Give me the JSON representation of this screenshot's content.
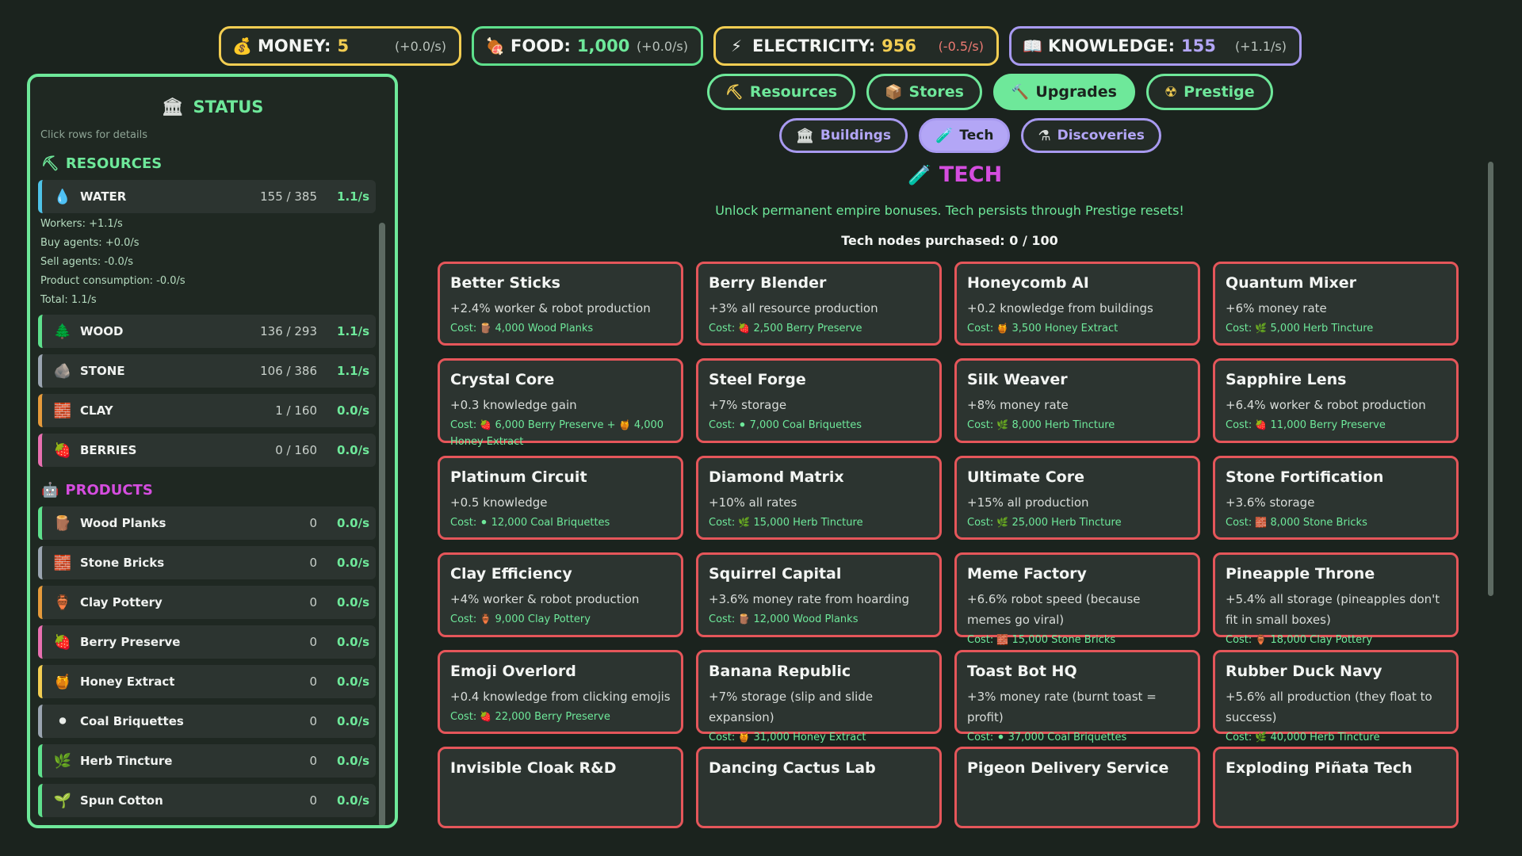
{
  "topbar": [
    {
      "id": "money",
      "icon": "💰",
      "icon_name": "money-bag-icon",
      "label": "MONEY:",
      "value": "5",
      "rate": "(+0.0/s)"
    },
    {
      "id": "food",
      "icon": "🍖",
      "icon_name": "meat-icon",
      "label": "FOOD:",
      "value": "1,000",
      "rate": "(+0.0/s)"
    },
    {
      "id": "elec",
      "icon": "⚡",
      "icon_name": "lightning-icon",
      "label": "ELECTRICITY:",
      "value": "956",
      "rate": "(-0.5/s)"
    },
    {
      "id": "know",
      "icon": "📖",
      "icon_name": "book-icon",
      "label": "KNOWLEDGE:",
      "value": "155",
      "rate": "(+1.1/s)"
    }
  ],
  "status": {
    "title": "STATUS",
    "hint": "Click rows for details",
    "resources_label": "RESOURCES",
    "products_label": "PRODUCTS",
    "resources": [
      {
        "name": "WATER",
        "icon": "💧",
        "icon_name": "water-drop-icon",
        "color": "#4fc3e8",
        "amount": "155 / 385",
        "rate": "1.1/s",
        "details": [
          "Workers: +1.1/s",
          "Buy agents: +0.0/s",
          "Sell agents: -0.0/s",
          "Product consumption: -0.0/s",
          "Total: 1.1/s"
        ]
      },
      {
        "name": "WOOD",
        "icon": "🌲",
        "icon_name": "tree-icon",
        "color": "#5ee08c",
        "amount": "136 / 293",
        "rate": "1.1/s"
      },
      {
        "name": "STONE",
        "icon": "🪨",
        "icon_name": "rock-icon",
        "color": "#9aa4b0",
        "amount": "106 / 386",
        "rate": "1.1/s"
      },
      {
        "name": "CLAY",
        "icon": "🧱",
        "icon_name": "clay-brick-icon",
        "color": "#e59a3b",
        "amount": "1 / 160",
        "rate": "0.0/s"
      },
      {
        "name": "BERRIES",
        "icon": "🍓",
        "icon_name": "strawberry-icon",
        "color": "#e86fb0",
        "amount": "0 / 160",
        "rate": "0.0/s"
      }
    ],
    "products": [
      {
        "name": "Wood Planks",
        "icon": "🪵",
        "icon_name": "log-icon",
        "color": "#5ee08c",
        "amount": "0",
        "rate": "0.0/s"
      },
      {
        "name": "Stone Bricks",
        "icon": "🧱",
        "icon_name": "brick-icon",
        "color": "#9aa4b0",
        "amount": "0",
        "rate": "0.0/s"
      },
      {
        "name": "Clay Pottery",
        "icon": "🏺",
        "icon_name": "pottery-icon",
        "color": "#e59a3b",
        "amount": "0",
        "rate": "0.0/s"
      },
      {
        "name": "Berry Preserve",
        "icon": "🍓",
        "icon_name": "strawberry-icon",
        "color": "#e86fb0",
        "amount": "0",
        "rate": "0.0/s"
      },
      {
        "name": "Honey Extract",
        "icon": "🍯",
        "icon_name": "honey-pot-icon",
        "color": "#f2cd52",
        "amount": "0",
        "rate": "0.0/s"
      },
      {
        "name": "Coal Briquettes",
        "icon": "⚫",
        "icon_name": "coal-icon",
        "color": "#9aa4b0",
        "amount": "0",
        "rate": "0.0/s"
      },
      {
        "name": "Herb Tincture",
        "icon": "🌿",
        "icon_name": "herb-icon",
        "color": "#5ee08c",
        "amount": "0",
        "rate": "0.0/s"
      },
      {
        "name": "Spun Cotton",
        "icon": "🌱",
        "icon_name": "plant-icon",
        "color": "#5ee08c",
        "amount": "0",
        "rate": "0.0/s"
      }
    ]
  },
  "tabs": [
    {
      "label": "Resources",
      "icon": "⛏",
      "icon_name": "pickaxe-icon",
      "active": false
    },
    {
      "label": "Stores",
      "icon": "📦",
      "icon_name": "box-icon",
      "active": false
    },
    {
      "label": "Upgrades",
      "icon": "🔨",
      "icon_name": "hammer-icon",
      "active": true
    },
    {
      "label": "Prestige",
      "icon": "☢",
      "icon_name": "radiation-icon",
      "active": false
    }
  ],
  "subtabs": [
    {
      "label": "Buildings",
      "icon": "🏛",
      "icon_name": "building-icon",
      "active": false
    },
    {
      "label": "Tech",
      "icon": "🧪",
      "icon_name": "test-tube-icon",
      "active": true
    },
    {
      "label": "Discoveries",
      "icon": "⚗",
      "icon_name": "flask-icon",
      "active": false
    }
  ],
  "tech": {
    "title": "TECH",
    "description": "Unlock permanent empire bonuses. Tech persists through Prestige resets!",
    "count": "Tech nodes purchased: 0 / 100",
    "cost_label": "Cost:",
    "cards": [
      {
        "title": "Better Sticks",
        "desc": "+2.4% worker & robot production",
        "cost": [
          {
            "icon": "🪵",
            "text": "4,000 Wood Planks"
          }
        ]
      },
      {
        "title": "Berry Blender",
        "desc": "+3% all resource production",
        "cost": [
          {
            "icon": "🍓",
            "text": "2,500 Berry Preserve"
          }
        ]
      },
      {
        "title": "Honeycomb AI",
        "desc": "+0.2 knowledge from buildings",
        "cost": [
          {
            "icon": "🍯",
            "text": "3,500 Honey Extract"
          }
        ]
      },
      {
        "title": "Quantum Mixer",
        "desc": "+6% money rate",
        "cost": [
          {
            "icon": "🌿",
            "text": "5,000 Herb Tincture"
          }
        ]
      },
      {
        "title": "Crystal Core",
        "desc": "+0.3 knowledge gain",
        "cost": [
          {
            "icon": "🍓",
            "text": "6,000 Berry Preserve +"
          },
          {
            "icon": "🍯",
            "text": "4,000 Honey Extract"
          }
        ]
      },
      {
        "title": "Steel Forge",
        "desc": "+7% storage",
        "cost": [
          {
            "icon": "⚫",
            "text": "7,000 Coal Briquettes"
          }
        ]
      },
      {
        "title": "Silk Weaver",
        "desc": "+8% money rate",
        "cost": [
          {
            "icon": "🌿",
            "text": "8,000 Herb Tincture"
          }
        ]
      },
      {
        "title": "Sapphire Lens",
        "desc": "+6.4% worker & robot production",
        "cost": [
          {
            "icon": "🍓",
            "text": "11,000 Berry Preserve"
          }
        ]
      },
      {
        "title": "Platinum Circuit",
        "desc": "+0.5 knowledge",
        "cost": [
          {
            "icon": "⚫",
            "text": "12,000 Coal Briquettes"
          }
        ]
      },
      {
        "title": "Diamond Matrix",
        "desc": "+10% all rates",
        "cost": [
          {
            "icon": "🌿",
            "text": "15,000 Herb Tincture"
          }
        ]
      },
      {
        "title": "Ultimate Core",
        "desc": "+15% all production",
        "cost": [
          {
            "icon": "🌿",
            "text": "25,000 Herb Tincture"
          }
        ]
      },
      {
        "title": "Stone Fortification",
        "desc": "+3.6% storage",
        "cost": [
          {
            "icon": "🧱",
            "text": "8,000 Stone Bricks"
          }
        ]
      },
      {
        "title": "Clay Efficiency",
        "desc": "+4% worker & robot production",
        "cost": [
          {
            "icon": "🏺",
            "text": "9,000 Clay Pottery"
          }
        ]
      },
      {
        "title": "Squirrel Capital",
        "desc": "+3.6% money rate from hoarding",
        "cost": [
          {
            "icon": "🪵",
            "text": "12,000 Wood Planks"
          }
        ]
      },
      {
        "title": "Meme Factory",
        "desc": "+6.6% robot speed (because memes go viral)",
        "cost": [
          {
            "icon": "🧱",
            "text": "15,000 Stone Bricks"
          }
        ]
      },
      {
        "title": "Pineapple Throne",
        "desc": "+5.4% all storage (pineapples don't fit in small boxes)",
        "cost": [
          {
            "icon": "🏺",
            "text": "18,000 Clay Pottery"
          }
        ]
      },
      {
        "title": "Emoji Overlord",
        "desc": "+0.4 knowledge from clicking emojis",
        "cost": [
          {
            "icon": "🍓",
            "text": "22,000 Berry Preserve"
          }
        ]
      },
      {
        "title": "Banana Republic",
        "desc": "+7% storage (slip and slide expansion)",
        "cost": [
          {
            "icon": "🍯",
            "text": "31,000 Honey Extract"
          }
        ]
      },
      {
        "title": "Toast Bot HQ",
        "desc": "+3% money rate (burnt toast = profit)",
        "cost": [
          {
            "icon": "⚫",
            "text": "37,000 Coal Briquettes"
          }
        ]
      },
      {
        "title": "Rubber Duck Navy",
        "desc": "+5.6% all production (they float to success)",
        "cost": [
          {
            "icon": "🌿",
            "text": "40,000 Herb Tincture"
          }
        ]
      },
      {
        "title": "Invisible Cloak R&D",
        "desc": "",
        "cost": []
      },
      {
        "title": "Dancing Cactus Lab",
        "desc": "",
        "cost": []
      },
      {
        "title": "Pigeon Delivery Service",
        "desc": "",
        "cost": []
      },
      {
        "title": "Exploding Piñata Tech",
        "desc": "",
        "cost": []
      }
    ]
  }
}
